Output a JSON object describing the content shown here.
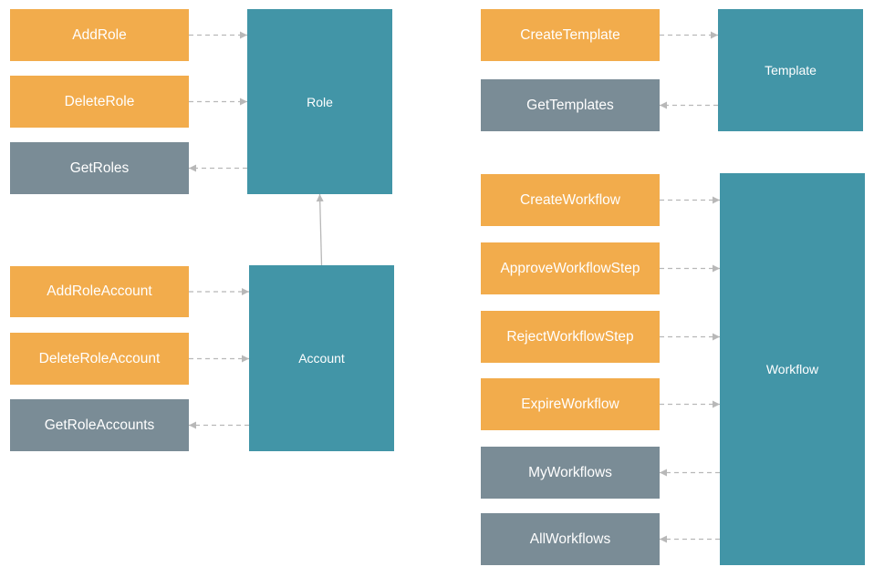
{
  "colors": {
    "write": "#F2AC4C",
    "read": "#7A8C96",
    "entity": "#4295A7",
    "arrow": "#B8B8B8"
  },
  "entities": {
    "role": "Role",
    "account": "Account",
    "template": "Template",
    "workflow": "Workflow"
  },
  "actions": {
    "add_role": "AddRole",
    "delete_role": "DeleteRole",
    "get_roles": "GetRoles",
    "add_role_account": "AddRoleAccount",
    "delete_role_account": "DeleteRoleAccount",
    "get_role_accounts": "GetRoleAccounts",
    "create_template": "CreateTemplate",
    "get_templates": "GetTemplates",
    "create_workflow": "CreateWorkflow",
    "approve_workflow_step": "ApproveWorkflowStep",
    "reject_workflow_step": "RejectWorkflowStep",
    "expire_workflow": "ExpireWorkflow",
    "my_workflows": "MyWorkflows",
    "all_workflows": "AllWorkflows"
  },
  "links": [
    {
      "from": "AddRole",
      "to": "Role",
      "style": "dashed"
    },
    {
      "from": "DeleteRole",
      "to": "Role",
      "style": "dashed"
    },
    {
      "from": "Role",
      "to": "GetRoles",
      "style": "dashed"
    },
    {
      "from": "Account",
      "to": "Role",
      "style": "solid"
    },
    {
      "from": "AddRoleAccount",
      "to": "Account",
      "style": "dashed"
    },
    {
      "from": "DeleteRoleAccount",
      "to": "Account",
      "style": "dashed"
    },
    {
      "from": "Account",
      "to": "GetRoleAccounts",
      "style": "dashed"
    },
    {
      "from": "CreateTemplate",
      "to": "Template",
      "style": "dashed"
    },
    {
      "from": "Template",
      "to": "GetTemplates",
      "style": "dashed"
    },
    {
      "from": "CreateWorkflow",
      "to": "Workflow",
      "style": "dashed"
    },
    {
      "from": "ApproveWorkflowStep",
      "to": "Workflow",
      "style": "dashed"
    },
    {
      "from": "RejectWorkflowStep",
      "to": "Workflow",
      "style": "dashed"
    },
    {
      "from": "ExpireWorkflow",
      "to": "Workflow",
      "style": "dashed"
    },
    {
      "from": "Workflow",
      "to": "MyWorkflows",
      "style": "dashed"
    },
    {
      "from": "Workflow",
      "to": "AllWorkflows",
      "style": "dashed"
    }
  ]
}
